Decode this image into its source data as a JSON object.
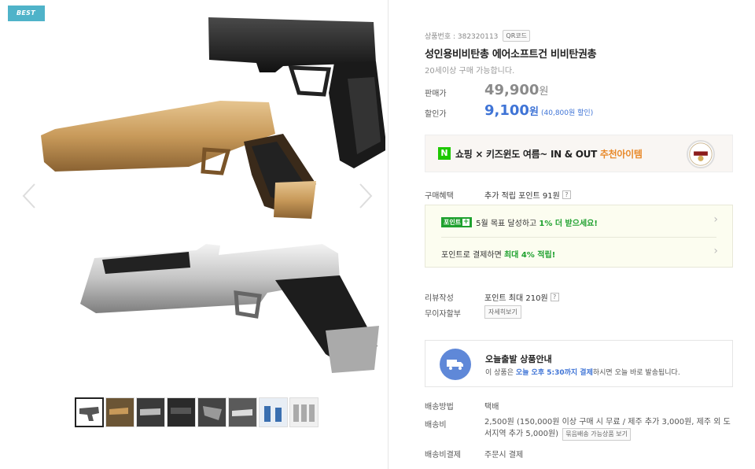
{
  "badge": "BEST",
  "product": {
    "number_label": "상품번호 : 382320113",
    "qr_label": "QR코드",
    "title": "성인용비비탄총 에어소프트건 비비탄권총",
    "age_note": "20세이상 구매 가능합니다."
  },
  "price": {
    "sale_label": "판매가",
    "sale_value": "49,900",
    "sale_unit": "원",
    "discount_label": "할인가",
    "discount_value": "9,100",
    "discount_unit": "원",
    "discount_note": "(40,800원 할인)"
  },
  "banner": {
    "logo": "N",
    "text_prefix": "쇼핑 × 키즈윈도  여름~ IN & OUT ",
    "text_highlight": "추천아이템"
  },
  "benefit": {
    "label": "구매혜택",
    "value": "추가 적립 포인트 91원",
    "help": "?"
  },
  "points": {
    "badge": "포인트",
    "badge_plus": "+",
    "row1_prefix": "5월 목표 달성하고 ",
    "row1_highlight": "1% 더 받으세요!",
    "row2_prefix": "포인트로 결제하면 ",
    "row2_highlight": "최대 4% 적립!",
    "chevron": "›"
  },
  "review": {
    "label": "리뷰작성",
    "value": "포인트 최대 210원",
    "help": "?"
  },
  "installment": {
    "label": "무이자할부",
    "button": "자세히보기"
  },
  "shipping_notice": {
    "title": "오늘출발 상품안내",
    "desc_prefix": "이 상품은 ",
    "desc_highlight": "오늘 오후 5:30까지 결제",
    "desc_suffix": "하시면 오늘 바로 발송됩니다."
  },
  "delivery": {
    "method_label": "배송방법",
    "method_value": "택배",
    "fee_label": "배송비",
    "fee_value": "2,500원 (150,000원 이상 구매 시 무료 / 제주 추가 3,000원, 제주 외 도서지역 추가 5,000원)",
    "fee_button": "묶음배송 가능상품 보기",
    "pay_label": "배송비결제",
    "pay_value": "주문시 결제"
  },
  "colors": {
    "accent_blue": "#3f74d6",
    "point_green": "#1fa12f",
    "best_badge": "#4fb3c9",
    "highlight_orange": "#e8892a"
  },
  "thumbnail_count": 8
}
